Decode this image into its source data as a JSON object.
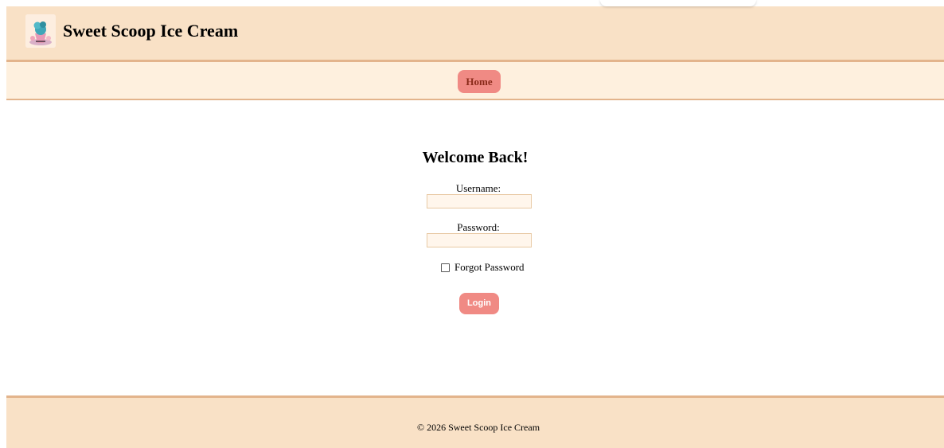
{
  "header": {
    "logo_icon": "ice-cream-icon",
    "title": "Sweet Scoop Ice Cream"
  },
  "nav": {
    "items": [
      {
        "label": "Home"
      }
    ]
  },
  "login": {
    "heading": "Welcome Back!",
    "username_label": "Username:",
    "username_value": "",
    "password_label": "Password:",
    "password_value": "",
    "forgot_label": "Forgot Password",
    "forgot_checked": false,
    "submit_label": "Login"
  },
  "footer": {
    "copyright": "© 2026 Sweet Scoop Ice Cream"
  },
  "colors": {
    "header_bg": "#f9e1c6",
    "nav_bg": "#fef0de",
    "border": "#e3b48c",
    "accent": "#f08a84",
    "input_bg": "#fff6ec"
  }
}
